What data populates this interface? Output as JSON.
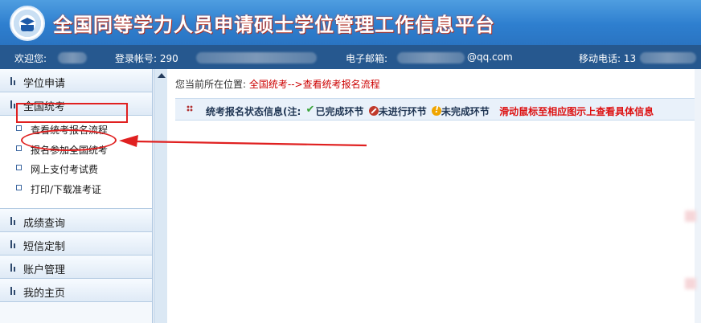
{
  "header": {
    "title": "全国同等学力人员申请硕士学位管理工作信息平台",
    "logo_icon": "university-crest-icon"
  },
  "userbar": {
    "welcome_label": "欢迎您:",
    "account_label": "登录帐号: 290",
    "email_label": "电子邮箱:",
    "email_suffix": "@qq.com",
    "phone_label": "移动电话: 13"
  },
  "sidebar": {
    "sections": [
      {
        "label": "学位申请"
      },
      {
        "label": "全国统考"
      },
      {
        "label": "成绩查询"
      },
      {
        "label": "短信定制"
      },
      {
        "label": "账户管理"
      },
      {
        "label": "我的主页"
      }
    ],
    "sub_items": [
      {
        "label": "查看统考报名流程"
      },
      {
        "label": "报名参加全国统考"
      },
      {
        "label": "网上支付考试费"
      },
      {
        "label": "打印/下载准考证"
      }
    ]
  },
  "main": {
    "breadcrumb_prefix": "您当前所在位置:",
    "breadcrumb_path": "全国统考-->查看统考报名流程",
    "status": {
      "title": "统考报名状态信息(注:",
      "done": "已完成环节",
      "not_started": "未进行环节",
      "incomplete": "未完成环节",
      "hint": "滑动鼠标至相应图示上查看具体信息"
    }
  },
  "colors": {
    "banner": "#2e7fcf",
    "userbar": "#26588f",
    "annotation": "#e02020",
    "link": "#cc0000"
  }
}
